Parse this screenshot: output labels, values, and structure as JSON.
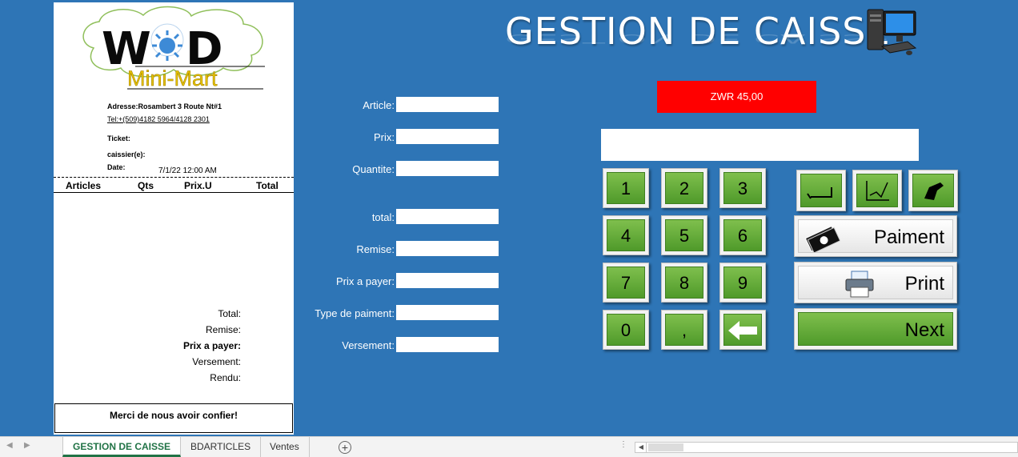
{
  "receipt": {
    "logo_text": "W D",
    "logo_subtitle": "Mini-Mart",
    "address": "Adresse:Rosambert 3 Route Nt#1",
    "tel": "Tel:+(509)4182 5964/4128 2301",
    "ticket_label": "Ticket:",
    "cashier_label": "caissier(e):",
    "date_label": "Date:",
    "date_value": "7/1/22 12:00 AM",
    "columns": [
      "Articles",
      "Qts",
      "Prix.U",
      "Total"
    ],
    "totals": [
      "Total:",
      "Remise:",
      "Prix a payer:",
      "Versement:",
      "Rendu:"
    ],
    "footer": "Merci de nous avoir confier!"
  },
  "form": {
    "fields": [
      {
        "label": "Article:",
        "value": ""
      },
      {
        "label": "Prix:",
        "value": ""
      },
      {
        "label": "Quantite:",
        "value": ""
      },
      {
        "label": "total:",
        "value": ""
      },
      {
        "label": "Remise:",
        "value": ""
      },
      {
        "label": "Prix a payer:",
        "value": ""
      },
      {
        "label": "Type de paiment:",
        "value": ""
      },
      {
        "label": "Versement:",
        "value": ""
      }
    ]
  },
  "header": {
    "title": "GESTION DE CAISSE",
    "icon": "computer-icon"
  },
  "amount": {
    "text": "ZWR 45,00",
    "color": "#ff0000"
  },
  "keypad": {
    "keys": [
      "1",
      "2",
      "3",
      "4",
      "5",
      "6",
      "7",
      "8",
      "9",
      "0",
      ","
    ],
    "backspace_icon": "arrow-left-icon"
  },
  "actions": {
    "icons": [
      "undo-icon",
      "edit-icon",
      "hand-icon"
    ],
    "paiment_label": "Paiment",
    "print_label": "Print",
    "next_label": "Next"
  },
  "tabs": {
    "items": [
      "GESTION DE CAISSE",
      "BDARTICLES",
      "Ventes"
    ],
    "active": "GESTION DE CAISSE",
    "add_label": "+"
  },
  "colors": {
    "background": "#2e75b6",
    "key_green": "#5aa832",
    "excel_green": "#217346"
  }
}
